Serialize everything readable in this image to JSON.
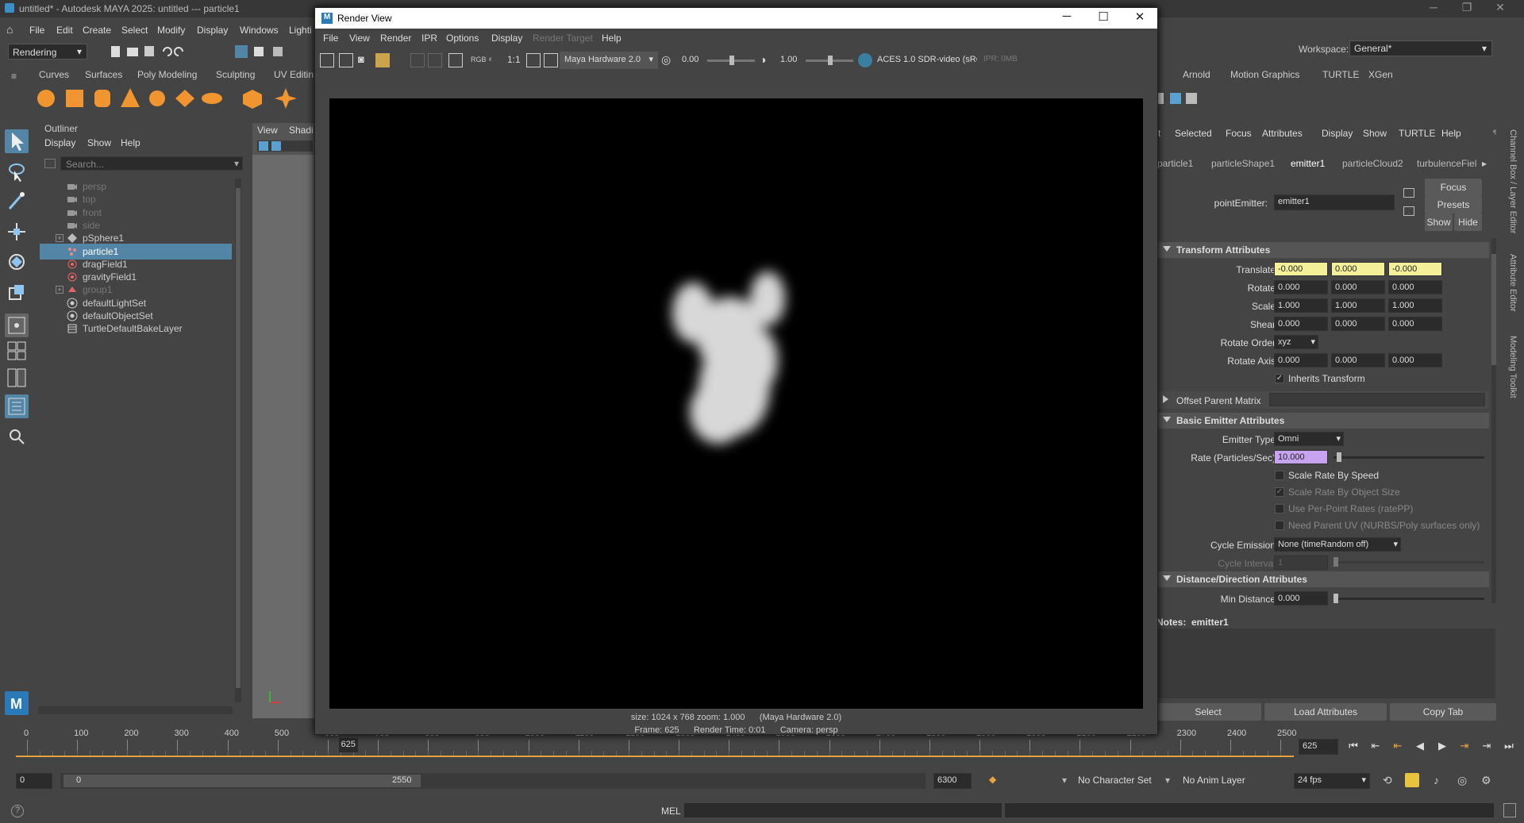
{
  "titlebar": {
    "text": "untitled* - Autodesk MAYA 2025: untitled   ---   particle1"
  },
  "menubar": {
    "items": [
      "File",
      "Edit",
      "Create",
      "Select",
      "Modify",
      "Display",
      "Windows",
      "Lighti"
    ],
    "mode": "Rendering",
    "workspace_label": "Workspace:",
    "workspace_value": "General*"
  },
  "shelf": {
    "tabs": [
      "Curves",
      "Surfaces",
      "Poly Modeling",
      "Sculpting",
      "UV Editin",
      "er",
      "Arnold",
      "Motion Graphics",
      "TURTLE",
      "XGen"
    ]
  },
  "outliner": {
    "title": "Outliner",
    "menu": [
      "Display",
      "Show",
      "Help"
    ],
    "search_placeholder": "Search...",
    "items": [
      {
        "label": "persp",
        "icon": "camera-icon",
        "dim": true
      },
      {
        "label": "top",
        "icon": "camera-icon",
        "dim": true
      },
      {
        "label": "front",
        "icon": "camera-icon",
        "dim": true
      },
      {
        "label": "side",
        "icon": "camera-icon",
        "dim": true
      },
      {
        "label": "pSphere1",
        "icon": "mesh-icon",
        "expand": true
      },
      {
        "label": "particle1",
        "icon": "particle-icon",
        "selected": true
      },
      {
        "label": "dragField1",
        "icon": "field-icon"
      },
      {
        "label": "gravityField1",
        "icon": "field-icon"
      },
      {
        "label": "group1",
        "icon": "group-icon",
        "dim": true,
        "expand": true
      },
      {
        "label": "defaultLightSet",
        "icon": "set-icon"
      },
      {
        "label": "defaultObjectSet",
        "icon": "set-icon"
      },
      {
        "label": "TurtleDefaultBakeLayer",
        "icon": "layer-icon"
      }
    ]
  },
  "viewport": {
    "menu": [
      "View",
      "Shadi"
    ]
  },
  "render_view": {
    "title": "Render View",
    "menu": [
      "File",
      "View",
      "Render",
      "IPR",
      "Options",
      "Display",
      "Render Target",
      "Help"
    ],
    "ratio": "1:1",
    "rgb": "RGB",
    "renderer": "Maya Hardware 2.0",
    "exposure": "0.00",
    "gamma": "1.00",
    "colorspace": "ACES 1.0 SDR-video (sRG",
    "ipr": "IPR: 0MB",
    "info_line1": "size: 1024 x 768 zoom: 1.000      (Maya Hardware 2.0)",
    "info_line2": "Frame: 625      Render Time: 0:01      Camera: persp"
  },
  "attribute_editor": {
    "menu": [
      "t",
      "Selected",
      "Focus",
      "Attributes",
      "Display",
      "Show",
      "TURTLE",
      "Help"
    ],
    "tabs": [
      "particle1",
      "particleShape1",
      "emitter1",
      "particleCloud2",
      "turbulenceFiel"
    ],
    "active_tab": "emitter1",
    "node_type_label": "pointEmitter:",
    "node_name": "emitter1",
    "buttons": {
      "focus": "Focus",
      "presets": "Presets",
      "show": "Show",
      "hide": "Hide"
    },
    "transform": {
      "title": "Transform Attributes",
      "translate": {
        "label": "Translate",
        "values": [
          "-0.000",
          "0.000",
          "-0.000"
        ]
      },
      "rotate": {
        "label": "Rotate",
        "values": [
          "0.000",
          "0.000",
          "0.000"
        ]
      },
      "scale": {
        "label": "Scale",
        "values": [
          "1.000",
          "1.000",
          "1.000"
        ]
      },
      "shear": {
        "label": "Shear",
        "values": [
          "0.000",
          "0.000",
          "0.000"
        ]
      },
      "rotate_order": {
        "label": "Rotate Order",
        "value": "xyz"
      },
      "rotate_axis": {
        "label": "Rotate Axis",
        "values": [
          "0.000",
          "0.000",
          "0.000"
        ]
      },
      "inherits": "Inherits Transform"
    },
    "offset_parent": "Offset Parent Matrix",
    "basic_emitter": {
      "title": "Basic Emitter Attributes",
      "emitter_type_label": "Emitter Type",
      "emitter_type": "Omni",
      "rate_label": "Rate (Particles/Sec)",
      "rate": "10.000",
      "rate_fraction": 0.02,
      "scale_rate_speed": "Scale Rate By Speed",
      "scale_rate_size": "Scale Rate By Object Size",
      "per_point": "Use Per-Point Rates (ratePP)",
      "parent_uv": "Need Parent UV (NURBS/Poly surfaces only)",
      "cycle_emission_label": "Cycle Emission",
      "cycle_emission": "None (timeRandom off)",
      "cycle_interval_label": "Cycle Interval",
      "cycle_interval": "1"
    },
    "distance": {
      "title": "Distance/Direction Attributes",
      "min_distance_label": "Min Distance",
      "min_distance": "0.000"
    },
    "notes": "Notes:  emitter1",
    "bottom": [
      "Select",
      "Load Attributes",
      "Copy Tab"
    ]
  },
  "right_strip": [
    "Channel Box / Layer Editor",
    "Attribute Editor",
    "Modeling Toolkit"
  ],
  "timeline": {
    "ticks": [
      "0",
      "100",
      "200",
      "300",
      "400",
      "500",
      "600",
      "700",
      "800",
      "900",
      "1000",
      "1100",
      "1200",
      "1300",
      "1400",
      "1500",
      "1600",
      "1700",
      "1800",
      "1900",
      "2000",
      "2100",
      "2200",
      "2300",
      "2400",
      "2500"
    ],
    "current_frame": "625",
    "frame_field": "625"
  },
  "range": {
    "start": "0",
    "range_start": "0",
    "range_end": "2550",
    "end": "6300",
    "character_set": "No Character Set",
    "anim_layer": "No Anim Layer",
    "fps": "24 fps"
  },
  "cmdline": {
    "label": "MEL"
  }
}
